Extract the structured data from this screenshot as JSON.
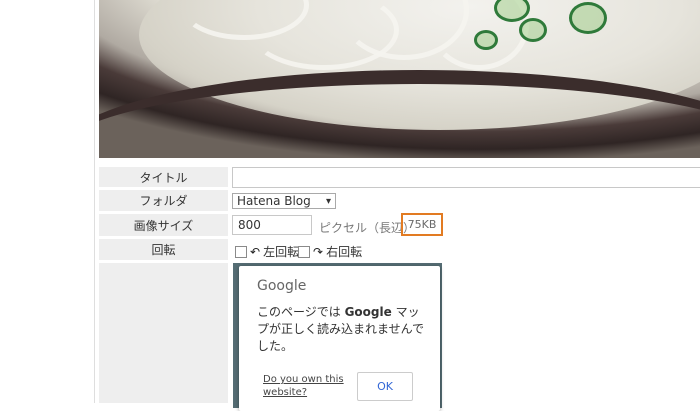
{
  "form": {
    "title_label": "タイトル",
    "title_value": "",
    "folder_label": "フォルダ",
    "folder_selected": "Hatena Blog",
    "size_label": "画像サイズ",
    "size_value": "800",
    "pixel_unit": "ピクセル（長辺）",
    "file_size": "75KB",
    "rotate_label": "回転",
    "rotate_left": "左回転",
    "rotate_right": "右回転"
  },
  "google_dialog": {
    "logo": "Google",
    "message_prefix": "このページでは ",
    "message_bold": "Google",
    "message_suffix": " マップが正しく読み込まれませんでした。",
    "own_link": "Do you own this website?",
    "ok_button": "OK"
  },
  "colors": {
    "badge_border": "#e27b22",
    "label_bg": "#eeeeee",
    "link_blue": "#3367d6"
  },
  "icons": {
    "select_caret": "▾",
    "rotate_left_icon": "↶",
    "rotate_right_icon": "↷"
  }
}
